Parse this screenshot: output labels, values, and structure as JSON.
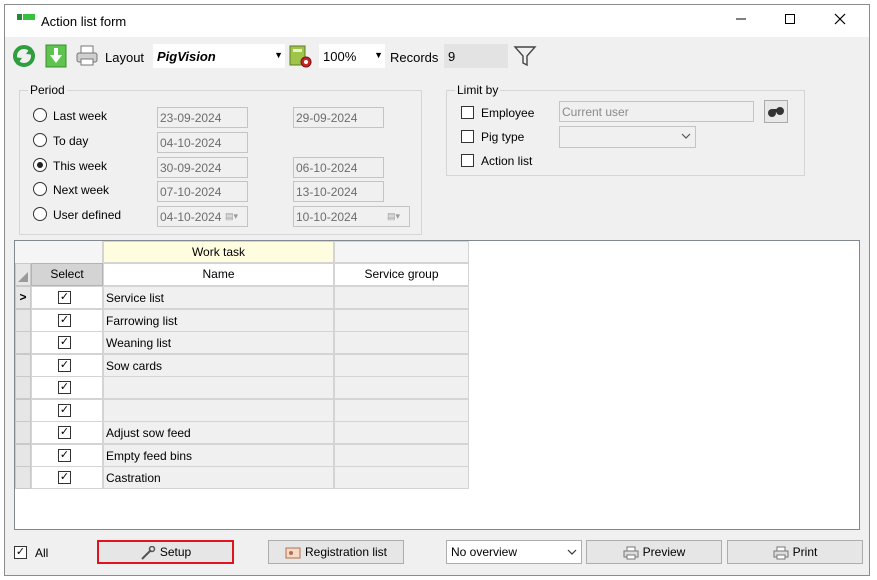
{
  "window": {
    "title": "Action list form",
    "minimize_icon": "minimize-icon",
    "maximize_icon": "maximize-icon",
    "close_icon": "close-icon"
  },
  "toolbar": {
    "layout_label": "Layout",
    "layout_value": "PigVision",
    "zoom_value": "100%",
    "records_label": "Records",
    "records_value": "9",
    "icons": [
      "refresh-icon",
      "download-icon",
      "print-icon",
      "layout-settings-icon",
      "filter-icon"
    ]
  },
  "period": {
    "legend": "Period",
    "options": [
      {
        "label": "Last week",
        "selected": false,
        "from": "23-09-2024",
        "to": "29-09-2024"
      },
      {
        "label": "To day",
        "selected": false,
        "from": "04-10-2024",
        "to": ""
      },
      {
        "label": "This week",
        "selected": true,
        "from": "30-09-2024",
        "to": "06-10-2024"
      },
      {
        "label": "Next week",
        "selected": false,
        "from": "07-10-2024",
        "to": "13-10-2024"
      },
      {
        "label": "User defined",
        "selected": false,
        "from": "04-10-2024",
        "to": "10-10-2024"
      }
    ]
  },
  "limit_by": {
    "legend": "Limit by",
    "employee_label": "Employee",
    "employee_value": "Current user",
    "pig_type_label": "Pig type",
    "pig_type_value": "",
    "action_list_label": "Action list"
  },
  "grid": {
    "group_header": "Work task",
    "columns": {
      "select": "Select",
      "name": "Name",
      "service_group": "Service group"
    },
    "current_row_marker": ">",
    "rows": [
      {
        "checked": true,
        "name": "Service list",
        "service_group": ""
      },
      {
        "checked": true,
        "name": "Farrowing list",
        "service_group": ""
      },
      {
        "checked": true,
        "name": "Weaning list",
        "service_group": ""
      },
      {
        "checked": true,
        "name": "Sow cards",
        "service_group": ""
      },
      {
        "checked": true,
        "name": "",
        "service_group": ""
      },
      {
        "checked": true,
        "name": "",
        "service_group": ""
      },
      {
        "checked": true,
        "name": "Adjust sow feed",
        "service_group": ""
      },
      {
        "checked": true,
        "name": "Empty feed bins",
        "service_group": ""
      },
      {
        "checked": true,
        "name": "Castration",
        "service_group": ""
      }
    ]
  },
  "footer": {
    "all_label": "All",
    "all_checked": true,
    "setup_label": "Setup",
    "registration_list_label": "Registration list",
    "overview_value": "No overview",
    "preview_label": "Preview",
    "print_label": "Print"
  },
  "colors": {
    "highlight_border": "#e0141e",
    "group_header_bg": "#fffde0",
    "window_bg": "#f0f0f0"
  }
}
